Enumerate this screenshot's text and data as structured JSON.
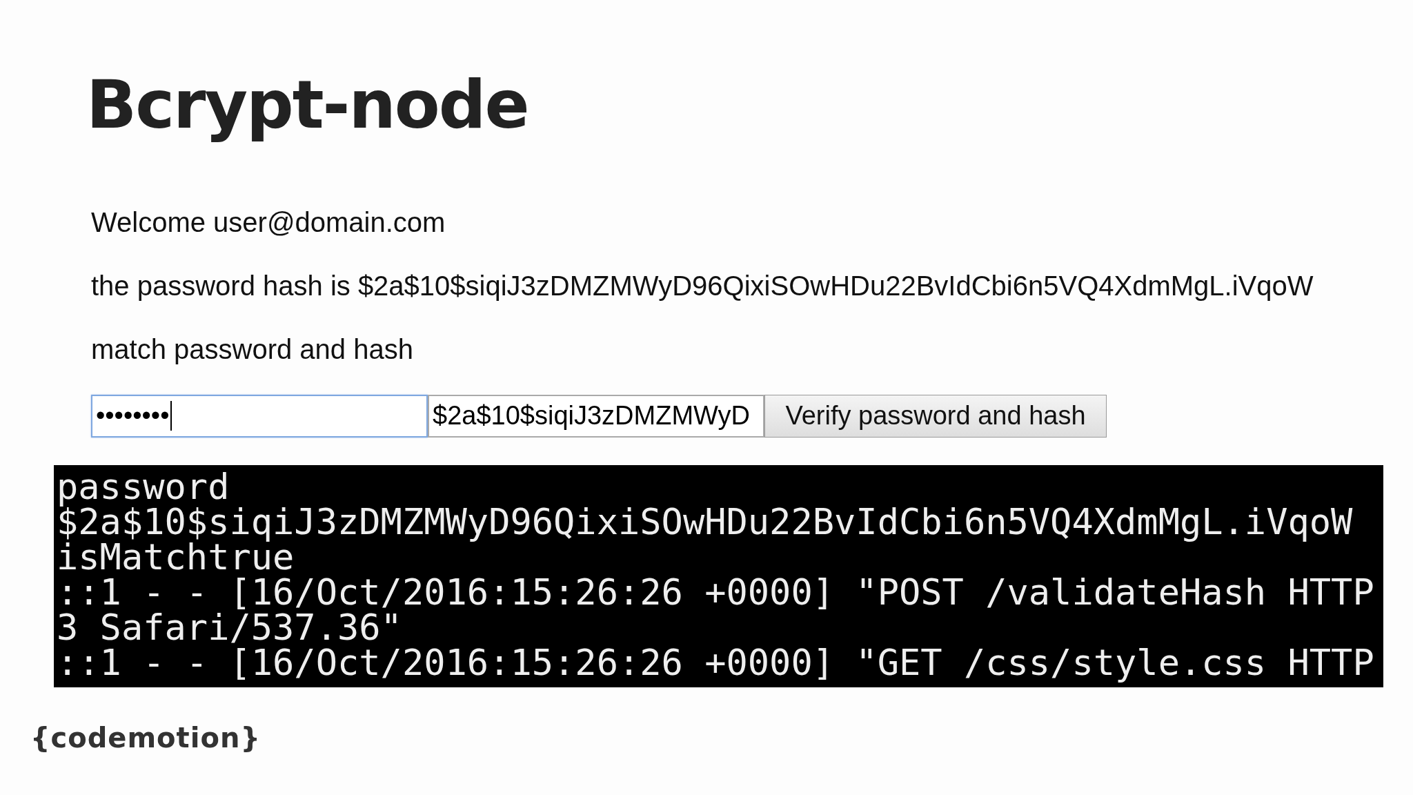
{
  "title": "Bcrypt-node",
  "page": {
    "lines": [
      "Welcome user@domain.com",
      "the password hash is $2a$10$siqiJ3zDMZMWyD96QixiSOwHDu22BvIdCbi6n5VQ4XdmMgL.iVqoW",
      "match password and hash"
    ],
    "form": {
      "password": {
        "value": "••••••••",
        "focused": true
      },
      "hash": {
        "value": "$2a$10$siqiJ3zDMZMWyD",
        "focused": false
      },
      "button": "Verify password and hash"
    }
  },
  "terminal": {
    "lines": [
      "password",
      "$2a$10$siqiJ3zDMZMWyD96QixiSOwHDu22BvIdCbi6n5VQ4XdmMgL.iVqoW",
      "isMatchtrue",
      "::1 - - [16/Oct/2016:15:26:26 +0000] \"POST /validateHash HTTP",
      "3 Safari/537.36\"",
      "::1 - - [16/Oct/2016:15:26:26 +0000] \"GET /css/style.css HTTP"
    ]
  },
  "logo": "{codemotion}"
}
